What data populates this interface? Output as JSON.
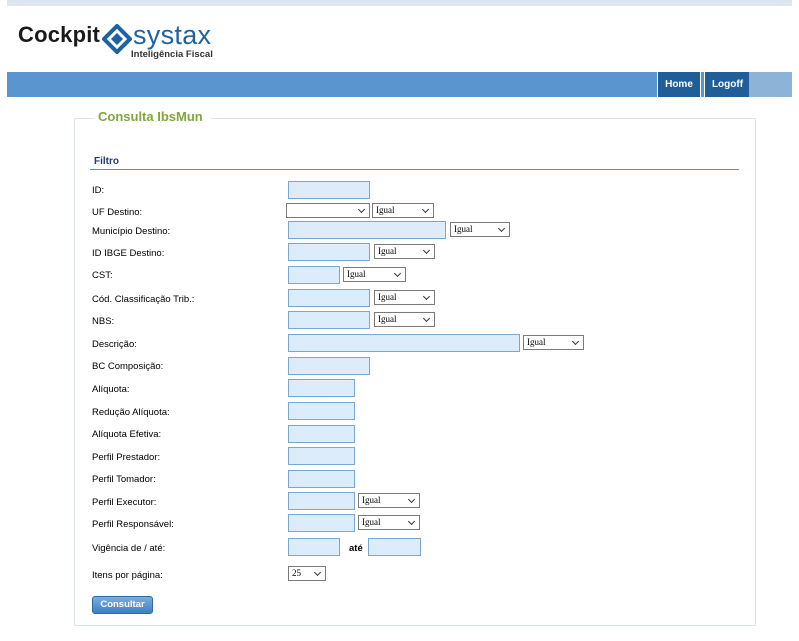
{
  "app": {
    "logo_text_left": "Cockpit",
    "logo_text_right": "systax",
    "logo_tagline": "Inteligência Fiscal"
  },
  "nav": {
    "home": "Home",
    "logoff": "Logoff"
  },
  "form": {
    "title": "Consulta IbsMun",
    "section": "Filtro",
    "labels": {
      "id": "ID:",
      "uf_destino": "UF Destino:",
      "municipio_destino": "Município Destino:",
      "id_ibge_destino": "ID IBGE Destino:",
      "cst": "CST:",
      "cod_classificacao": "Cód. Classificação Trib.:",
      "nbs": "NBS:",
      "descricao": "Descrição:",
      "bc_composicao": "BC Composição:",
      "aliquota": "Alíquota:",
      "reducao_aliquota": "Redução Alíquota:",
      "aliquota_efetiva": "Alíquota Efetiva:",
      "perfil_prestador": "Perfil Prestador:",
      "perfil_tomador": "Perfil Tomador:",
      "perfil_executor": "Perfil Executor:",
      "perfil_responsavel": "Perfil Responsável:",
      "vigencia": "Vigência de / até:",
      "vigencia_ate": "até",
      "itens_por_pagina": "Itens por página:"
    },
    "values": {
      "id": "",
      "uf_destino": "",
      "municipio_destino": "",
      "id_ibge_destino": "",
      "cst": "",
      "cod_classificacao": "",
      "nbs": "",
      "descricao": "",
      "bc_composicao": "",
      "aliquota": "",
      "reducao_aliquota": "",
      "aliquota_efetiva": "",
      "perfil_prestador": "",
      "perfil_tomador": "",
      "perfil_executor": "",
      "perfil_responsavel": "",
      "vigencia_de": "",
      "vigencia_ate": ""
    },
    "match_operator": "Igual",
    "itens_por_pagina_value": "25",
    "submit": "Consultar"
  },
  "colors": {
    "navbar": "#5b95cf",
    "nav_button": "#215e99",
    "title_green": "#7fa83a",
    "section_blue": "#1f3b70",
    "input_bg": "#dcecfb"
  }
}
